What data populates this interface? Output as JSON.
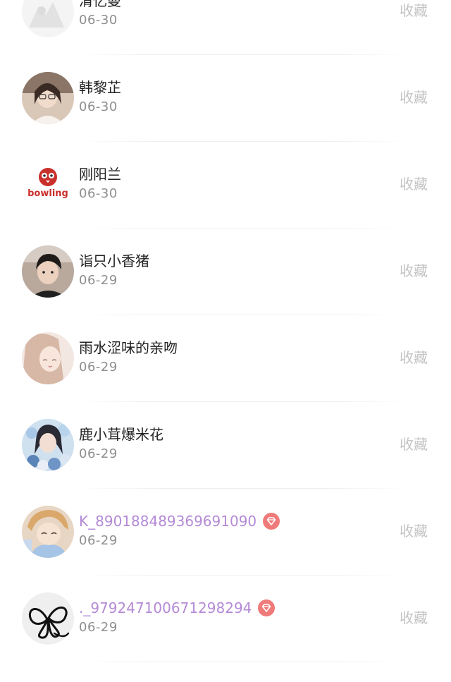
{
  "list": {
    "items": [
      {
        "name": "清忆曼",
        "date": "06-30",
        "action": "收藏",
        "vip": false,
        "avatar": "avatar-faded-photo"
      },
      {
        "name": "韩黎芷",
        "date": "06-30",
        "action": "收藏",
        "vip": false,
        "avatar": "avatar-girl-photo"
      },
      {
        "name": "刚阳兰",
        "date": "06-30",
        "action": "收藏",
        "vip": false,
        "avatar": "avatar-bowling-logo",
        "logo_text": "bowling"
      },
      {
        "name": "诣只小香猪",
        "date": "06-29",
        "action": "收藏",
        "vip": false,
        "avatar": "avatar-boy-photo"
      },
      {
        "name": "雨水涩味的亲吻",
        "date": "06-29",
        "action": "收藏",
        "vip": false,
        "avatar": "avatar-girl-photo"
      },
      {
        "name": "鹿小茸爆米花",
        "date": "06-29",
        "action": "收藏",
        "vip": false,
        "avatar": "avatar-girl-flowers-photo"
      },
      {
        "name": "K_890188489369691090",
        "date": "06-29",
        "action": "收藏",
        "vip": true,
        "avatar": "avatar-anime-photo"
      },
      {
        "name": "._979247100671298294",
        "date": "06-29",
        "action": "收藏",
        "vip": true,
        "avatar": "avatar-butterfly-sketch"
      }
    ]
  },
  "colors": {
    "name": "#222222",
    "vip_name": "#b48ad6",
    "date": "#8e8e8e",
    "action": "#c4c4c4",
    "vip_badge": "#ef7a7a"
  },
  "icons": {
    "vip_badge": "diamond-badge-icon"
  }
}
